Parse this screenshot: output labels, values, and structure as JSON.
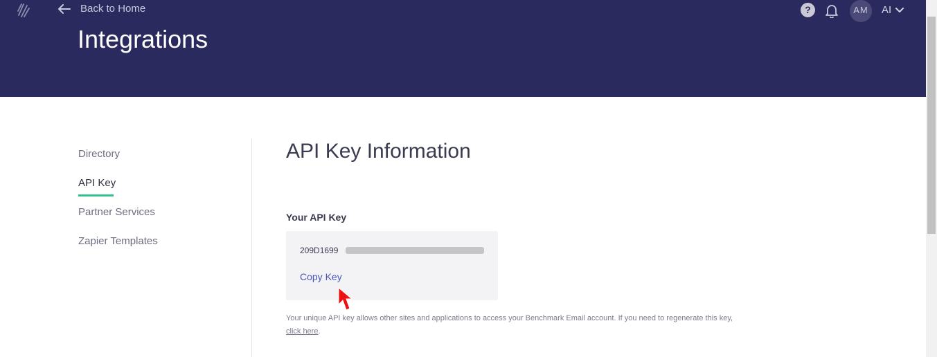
{
  "header": {
    "back_label": "Back to Home",
    "page_title": "Integrations",
    "help_icon_glyph": "?",
    "avatar_initials": "AM",
    "account_label": "AI",
    "background_color": "#2b2a5e"
  },
  "sidebar": {
    "items": [
      {
        "label": "Directory",
        "active": false
      },
      {
        "label": "API Key",
        "active": true
      },
      {
        "label": "Partner Services",
        "active": false
      },
      {
        "label": "Zapier Templates",
        "active": false
      }
    ],
    "active_indicator_color": "#32c38d"
  },
  "main": {
    "section_title": "API Key Information",
    "key_label": "Your API Key",
    "key_value_visible": "209D1699",
    "copy_label": "Copy Key",
    "note_text": "Your unique API key allows other sites and applications to access your Benchmark Email account. If you need to regenerate this key, ",
    "note_link": "click here",
    "note_end": "."
  },
  "icons": [
    "logo-icon",
    "back-arrow-icon",
    "help-icon",
    "bell-icon",
    "chevron-down-icon",
    "mouse-cursor-icon"
  ]
}
